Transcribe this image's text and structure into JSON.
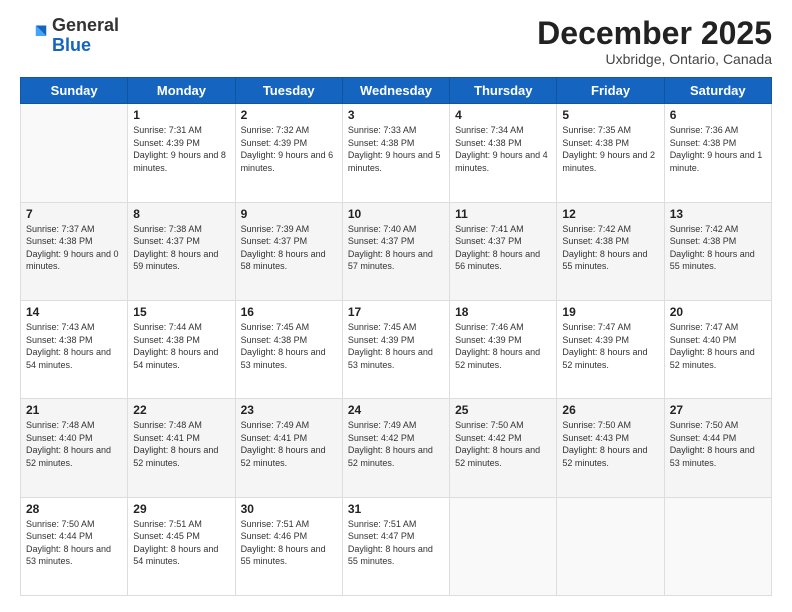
{
  "header": {
    "logo": {
      "line1": "General",
      "line2": "Blue"
    },
    "title": "December 2025",
    "location": "Uxbridge, Ontario, Canada"
  },
  "days_of_week": [
    "Sunday",
    "Monday",
    "Tuesday",
    "Wednesday",
    "Thursday",
    "Friday",
    "Saturday"
  ],
  "weeks": [
    [
      {
        "day": null,
        "info": null
      },
      {
        "day": "1",
        "sunrise": "7:31 AM",
        "sunset": "4:39 PM",
        "daylight": "9 hours and 8 minutes."
      },
      {
        "day": "2",
        "sunrise": "7:32 AM",
        "sunset": "4:39 PM",
        "daylight": "9 hours and 6 minutes."
      },
      {
        "day": "3",
        "sunrise": "7:33 AM",
        "sunset": "4:38 PM",
        "daylight": "9 hours and 5 minutes."
      },
      {
        "day": "4",
        "sunrise": "7:34 AM",
        "sunset": "4:38 PM",
        "daylight": "9 hours and 4 minutes."
      },
      {
        "day": "5",
        "sunrise": "7:35 AM",
        "sunset": "4:38 PM",
        "daylight": "9 hours and 2 minutes."
      },
      {
        "day": "6",
        "sunrise": "7:36 AM",
        "sunset": "4:38 PM",
        "daylight": "9 hours and 1 minute."
      }
    ],
    [
      {
        "day": "7",
        "sunrise": "7:37 AM",
        "sunset": "4:38 PM",
        "daylight": "9 hours and 0 minutes."
      },
      {
        "day": "8",
        "sunrise": "7:38 AM",
        "sunset": "4:37 PM",
        "daylight": "8 hours and 59 minutes."
      },
      {
        "day": "9",
        "sunrise": "7:39 AM",
        "sunset": "4:37 PM",
        "daylight": "8 hours and 58 minutes."
      },
      {
        "day": "10",
        "sunrise": "7:40 AM",
        "sunset": "4:37 PM",
        "daylight": "8 hours and 57 minutes."
      },
      {
        "day": "11",
        "sunrise": "7:41 AM",
        "sunset": "4:37 PM",
        "daylight": "8 hours and 56 minutes."
      },
      {
        "day": "12",
        "sunrise": "7:42 AM",
        "sunset": "4:38 PM",
        "daylight": "8 hours and 55 minutes."
      },
      {
        "day": "13",
        "sunrise": "7:42 AM",
        "sunset": "4:38 PM",
        "daylight": "8 hours and 55 minutes."
      }
    ],
    [
      {
        "day": "14",
        "sunrise": "7:43 AM",
        "sunset": "4:38 PM",
        "daylight": "8 hours and 54 minutes."
      },
      {
        "day": "15",
        "sunrise": "7:44 AM",
        "sunset": "4:38 PM",
        "daylight": "8 hours and 54 minutes."
      },
      {
        "day": "16",
        "sunrise": "7:45 AM",
        "sunset": "4:38 PM",
        "daylight": "8 hours and 53 minutes."
      },
      {
        "day": "17",
        "sunrise": "7:45 AM",
        "sunset": "4:39 PM",
        "daylight": "8 hours and 53 minutes."
      },
      {
        "day": "18",
        "sunrise": "7:46 AM",
        "sunset": "4:39 PM",
        "daylight": "8 hours and 52 minutes."
      },
      {
        "day": "19",
        "sunrise": "7:47 AM",
        "sunset": "4:39 PM",
        "daylight": "8 hours and 52 minutes."
      },
      {
        "day": "20",
        "sunrise": "7:47 AM",
        "sunset": "4:40 PM",
        "daylight": "8 hours and 52 minutes."
      }
    ],
    [
      {
        "day": "21",
        "sunrise": "7:48 AM",
        "sunset": "4:40 PM",
        "daylight": "8 hours and 52 minutes."
      },
      {
        "day": "22",
        "sunrise": "7:48 AM",
        "sunset": "4:41 PM",
        "daylight": "8 hours and 52 minutes."
      },
      {
        "day": "23",
        "sunrise": "7:49 AM",
        "sunset": "4:41 PM",
        "daylight": "8 hours and 52 minutes."
      },
      {
        "day": "24",
        "sunrise": "7:49 AM",
        "sunset": "4:42 PM",
        "daylight": "8 hours and 52 minutes."
      },
      {
        "day": "25",
        "sunrise": "7:50 AM",
        "sunset": "4:42 PM",
        "daylight": "8 hours and 52 minutes."
      },
      {
        "day": "26",
        "sunrise": "7:50 AM",
        "sunset": "4:43 PM",
        "daylight": "8 hours and 52 minutes."
      },
      {
        "day": "27",
        "sunrise": "7:50 AM",
        "sunset": "4:44 PM",
        "daylight": "8 hours and 53 minutes."
      }
    ],
    [
      {
        "day": "28",
        "sunrise": "7:50 AM",
        "sunset": "4:44 PM",
        "daylight": "8 hours and 53 minutes."
      },
      {
        "day": "29",
        "sunrise": "7:51 AM",
        "sunset": "4:45 PM",
        "daylight": "8 hours and 54 minutes."
      },
      {
        "day": "30",
        "sunrise": "7:51 AM",
        "sunset": "4:46 PM",
        "daylight": "8 hours and 55 minutes."
      },
      {
        "day": "31",
        "sunrise": "7:51 AM",
        "sunset": "4:47 PM",
        "daylight": "8 hours and 55 minutes."
      },
      {
        "day": null,
        "info": null
      },
      {
        "day": null,
        "info": null
      },
      {
        "day": null,
        "info": null
      }
    ]
  ],
  "labels": {
    "sunrise_prefix": "Sunrise: ",
    "sunset_prefix": "Sunset: ",
    "daylight_prefix": "Daylight: "
  }
}
